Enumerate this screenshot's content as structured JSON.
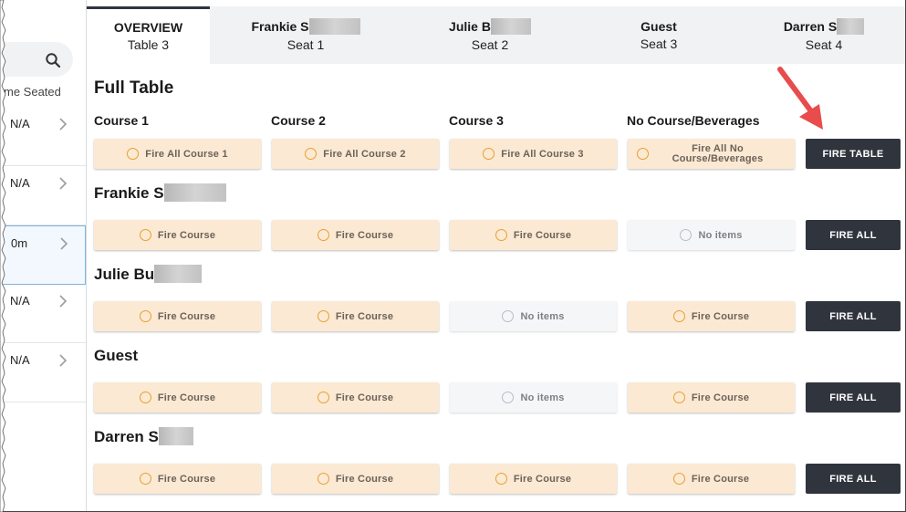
{
  "left_panel": {
    "column_header": "me Seated",
    "rows": [
      {
        "value": "N/A"
      },
      {
        "value": "N/A"
      },
      {
        "value": "0m"
      },
      {
        "value": "N/A"
      },
      {
        "value": "N/A"
      }
    ]
  },
  "tabs": [
    {
      "title": "OVERVIEW",
      "subtitle": "Table 3",
      "active": true
    },
    {
      "title": "Frankie S",
      "subtitle": "Seat 1"
    },
    {
      "title": "Julie B",
      "subtitle": "Seat 2"
    },
    {
      "title": "Guest",
      "subtitle": "Seat 3"
    },
    {
      "title": "Darren S",
      "subtitle": "Seat 4"
    }
  ],
  "main": {
    "title": "Full Table",
    "course_headers": [
      "Course 1",
      "Course 2",
      "Course 3",
      "No Course/Beverages"
    ],
    "full_table_buttons": [
      "Fire All Course 1",
      "Fire All Course 2",
      "Fire All Course 3",
      "Fire All No\nCourse/Beverages"
    ],
    "fire_table_label": "FIRE TABLE",
    "seats": [
      {
        "name": "Frankie S",
        "buttons": [
          "Fire Course",
          "Fire Course",
          "Fire Course",
          "No items"
        ],
        "fire_all_label": "FIRE ALL"
      },
      {
        "name": "Julie Bu",
        "buttons": [
          "Fire Course",
          "Fire Course",
          "No items",
          "Fire Course"
        ],
        "fire_all_label": "FIRE ALL"
      },
      {
        "name": "Guest",
        "buttons": [
          "Fire Course",
          "Fire Course",
          "No items",
          "Fire Course"
        ],
        "fire_all_label": "FIRE ALL"
      },
      {
        "name": "Darren S",
        "buttons": [
          "Fire Course",
          "Fire Course",
          "Fire Course",
          "Fire Course"
        ],
        "fire_all_label": "FIRE ALL"
      }
    ]
  },
  "colors": {
    "fire_button_bg": "#fbe9d3",
    "no_items_bg": "#f5f6f8",
    "dark_button_bg": "#2f343d",
    "circle_accent": "#e8a030",
    "arrow": "#e84c4c"
  }
}
